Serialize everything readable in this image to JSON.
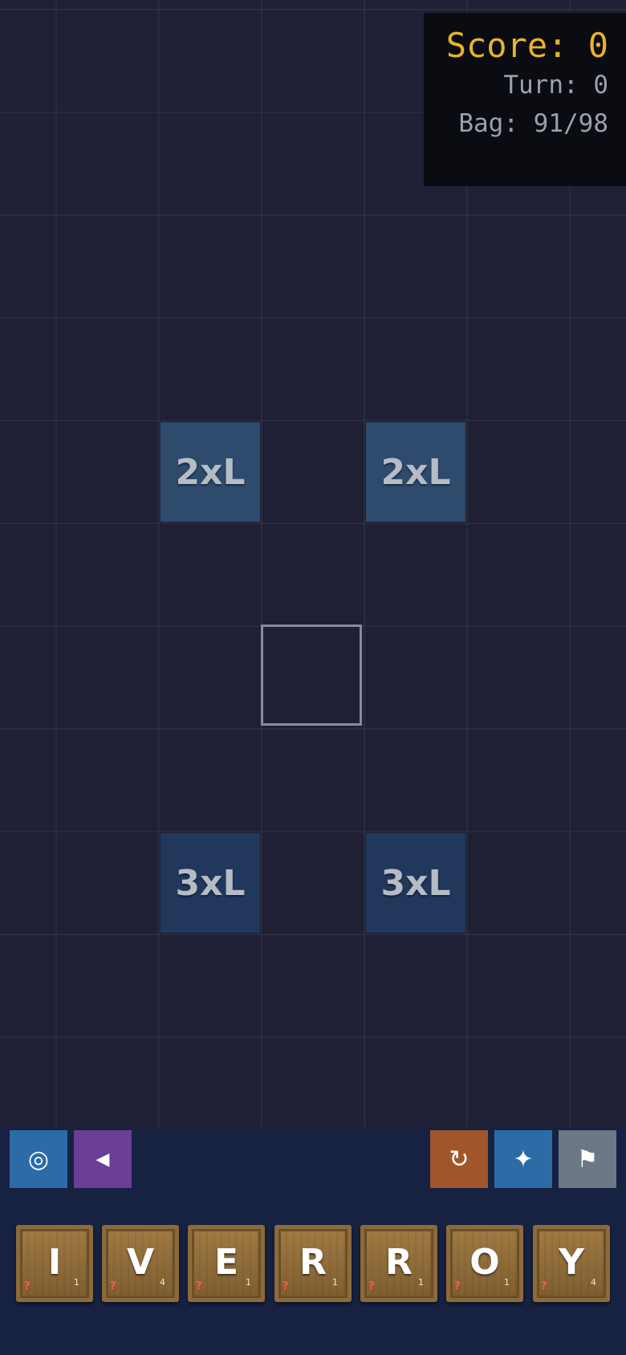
{
  "hud": {
    "score_label": "Score:",
    "score": "0",
    "turn_label": "Turn:",
    "turn": "0",
    "bag_label": "Bag:",
    "bag": "91/98"
  },
  "board": {
    "premium_squares": [
      {
        "label": "2xL",
        "color": "#2e4a6c"
      },
      {
        "label": "2xL",
        "color": "#2e4a6c"
      },
      {
        "label": "3xL",
        "color": "#21385c"
      },
      {
        "label": "3xL",
        "color": "#21385c"
      }
    ],
    "center_square": {
      "border_color": "#8a8a9e"
    },
    "background": "#1f2035"
  },
  "controls": {
    "target_icon": "◎",
    "back_icon": "◀",
    "reset_icon": "↻",
    "sparkle_icon": "✦",
    "flag_icon": "⚑",
    "colors": {
      "target": "#2b6ca6",
      "back": "#6a3d96",
      "reset": "#a0562a",
      "sparkle": "#2b6ca6",
      "flag": "#6c7886",
      "panel": "#172141"
    }
  },
  "rack": {
    "tiles": [
      {
        "letter": "I",
        "points": "1",
        "mark": "?"
      },
      {
        "letter": "V",
        "points": "4",
        "mark": "?"
      },
      {
        "letter": "E",
        "points": "1",
        "mark": "?"
      },
      {
        "letter": "R",
        "points": "1",
        "mark": "?"
      },
      {
        "letter": "R",
        "points": "1",
        "mark": "?"
      },
      {
        "letter": "O",
        "points": "1",
        "mark": "?"
      },
      {
        "letter": "Y",
        "points": "4",
        "mark": "?"
      }
    ]
  },
  "accent": {
    "score": "#e9b42a",
    "info": "#9aa1ac"
  }
}
